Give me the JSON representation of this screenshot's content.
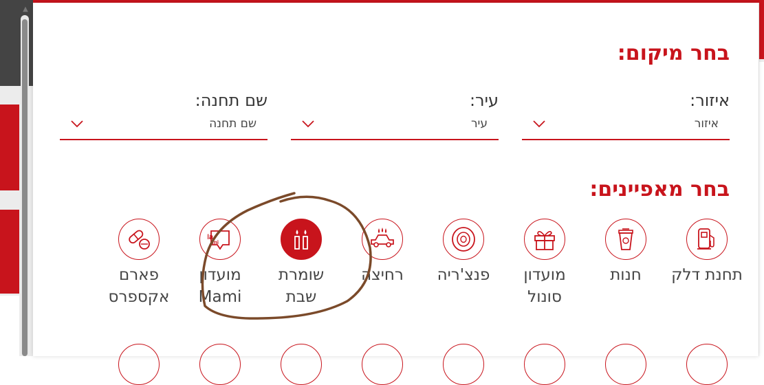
{
  "location": {
    "title": "בחר מיקום:",
    "fields": [
      {
        "label": "איזור:",
        "value": "איזור"
      },
      {
        "label": "עיר:",
        "value": "עיר"
      },
      {
        "label": "שם תחנה:",
        "value": "שם תחנה"
      }
    ]
  },
  "features": {
    "title": "בחר מאפיינים:",
    "items": [
      {
        "label": "תחנת דלק",
        "icon": "fuel-pump-icon",
        "selected": false
      },
      {
        "label": "חנות",
        "icon": "coffee-cup-icon",
        "selected": false
      },
      {
        "label": "מועדון סונול",
        "icon": "gift-icon",
        "selected": false
      },
      {
        "label": "פנצ'ריה",
        "icon": "tire-icon",
        "selected": false
      },
      {
        "label": "רחיצה",
        "icon": "car-wash-icon",
        "selected": false
      },
      {
        "label": "שומרת שבת",
        "icon": "candles-icon",
        "selected": true
      },
      {
        "label": "מועדון Mami",
        "icon": "mami-logo-icon",
        "selected": false
      },
      {
        "label": "פארם אקספרס",
        "icon": "pills-icon",
        "selected": false
      }
    ]
  },
  "colors": {
    "accent": "#c8141c",
    "annotation": "#7b4a2a"
  }
}
